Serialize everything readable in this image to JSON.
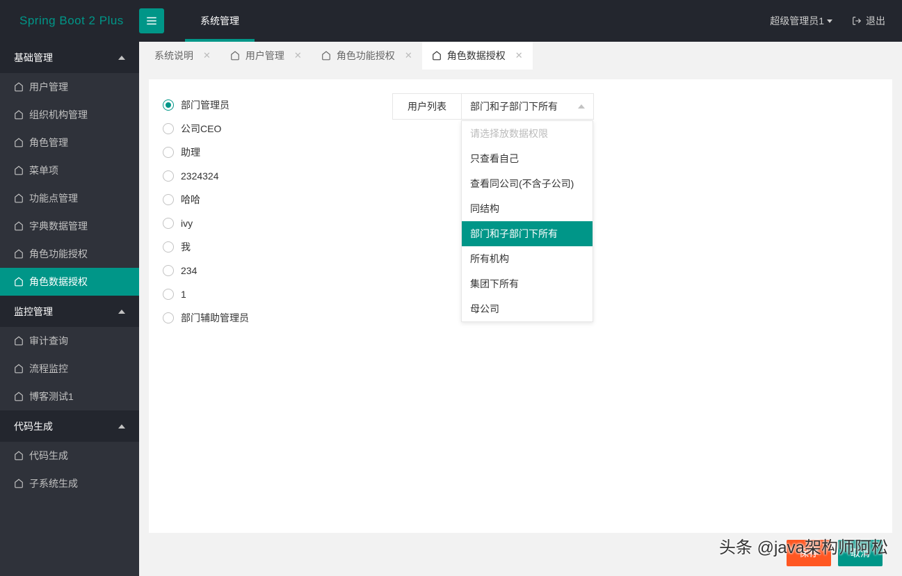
{
  "header": {
    "logo": "Spring Boot 2 Plus",
    "topnav": "系统管理",
    "user": "超级管理员1",
    "logout": "退出"
  },
  "sidebar": {
    "groups": [
      {
        "label": "基础管理",
        "items": [
          {
            "label": "用户管理",
            "active": false
          },
          {
            "label": "组织机构管理",
            "active": false
          },
          {
            "label": "角色管理",
            "active": false
          },
          {
            "label": "菜单项",
            "active": false
          },
          {
            "label": "功能点管理",
            "active": false
          },
          {
            "label": "字典数据管理",
            "active": false
          },
          {
            "label": "角色功能授权",
            "active": false
          },
          {
            "label": "角色数据授权",
            "active": true
          }
        ]
      },
      {
        "label": "监控管理",
        "items": [
          {
            "label": "审计查询",
            "active": false
          },
          {
            "label": "流程监控",
            "active": false
          },
          {
            "label": "博客测试1",
            "active": false
          }
        ]
      },
      {
        "label": "代码生成",
        "items": [
          {
            "label": "代码生成",
            "active": false
          },
          {
            "label": "子系统生成",
            "active": false
          }
        ]
      }
    ]
  },
  "tabs": [
    {
      "label": "系统说明",
      "icon": false,
      "closable": true,
      "active": false
    },
    {
      "label": "用户管理",
      "icon": true,
      "closable": true,
      "active": false
    },
    {
      "label": "角色功能授权",
      "icon": true,
      "closable": true,
      "active": false
    },
    {
      "label": "角色数据授权",
      "icon": true,
      "closable": true,
      "active": true
    }
  ],
  "main": {
    "roles": [
      {
        "label": "部门管理员",
        "checked": true
      },
      {
        "label": "公司CEO",
        "checked": false
      },
      {
        "label": "助理",
        "checked": false
      },
      {
        "label": "2324324",
        "checked": false
      },
      {
        "label": "哈哈",
        "checked": false
      },
      {
        "label": "ivy",
        "checked": false
      },
      {
        "label": "我",
        "checked": false
      },
      {
        "label": "234",
        "checked": false
      },
      {
        "label": "1",
        "checked": false
      },
      {
        "label": "部门辅助管理员",
        "checked": false
      }
    ],
    "select_label": "用户列表",
    "select_value": "部门和子部门下所有",
    "dropdown": [
      {
        "label": "请选择放数据权限",
        "placeholder": true
      },
      {
        "label": "只查看自己"
      },
      {
        "label": "查看同公司(不含子公司)"
      },
      {
        "label": "同结构"
      },
      {
        "label": "部门和子部门下所有",
        "selected": true
      },
      {
        "label": "所有机构"
      },
      {
        "label": "集团下所有"
      },
      {
        "label": "母公司"
      }
    ]
  },
  "footer": {
    "save": "保存",
    "cancel": "取消"
  },
  "watermark": "头条 @java架构师阿松"
}
